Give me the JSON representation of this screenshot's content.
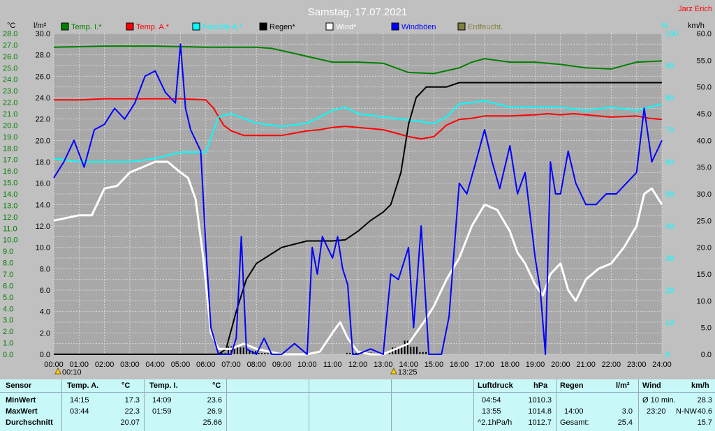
{
  "title": "Samstag, 17.07.2021",
  "author": "Jarz Erich",
  "units": {
    "left_c": "°C",
    "left_rain": "l/m²",
    "pct": "%",
    "kmh": "km/h"
  },
  "legend": [
    {
      "label": "Temp. I.*",
      "color": "#008000"
    },
    {
      "label": "Temp. A.*",
      "color": "#ff0000"
    },
    {
      "label": "Feuchte A.*",
      "color": "#00ffff"
    },
    {
      "label": "Regen*",
      "color": "#000000"
    },
    {
      "label": "Wind*",
      "color": "#ffffff"
    },
    {
      "label": "Windböen",
      "color": "#0000ff"
    },
    {
      "label": "Erdfeucht.",
      "color": "#808040"
    }
  ],
  "markers": [
    {
      "label": "00:10"
    },
    {
      "label": "13:25"
    }
  ],
  "chart_data": {
    "type": "line",
    "x_ticks": [
      "00:00",
      "01:00",
      "02:00",
      "03:00",
      "04:00",
      "05:00",
      "06:00",
      "07:00",
      "08:00",
      "09:00",
      "10:00",
      "11:00",
      "12:00",
      "13:00",
      "14:00",
      "15:00",
      "16:00",
      "17:00",
      "18:00",
      "19:00",
      "20:00",
      "21:00",
      "22:00",
      "23:00",
      "24:00"
    ],
    "y_left_temp_ticks": [
      "28.0",
      "27.0",
      "26.0",
      "25.0",
      "24.0",
      "23.0",
      "22.0",
      "21.0",
      "20.0",
      "19.0",
      "18.0",
      "17.0",
      "16.0",
      "15.0",
      "14.0",
      "13.0",
      "12.0",
      "11.0",
      "10.0",
      "9.0",
      "8.0",
      "7.0",
      "6.0",
      "5.0",
      "4.0",
      "3.0",
      "2.0",
      "1.0",
      "0.0"
    ],
    "y_left_rain_ticks": [
      "30.0",
      "28.0",
      "26.0",
      "24.0",
      "22.0",
      "20.0",
      "18.0",
      "16.0",
      "14.0",
      "12.0",
      "10.0",
      "8.0",
      "6.0",
      "4.0",
      "2.0",
      "0.0"
    ],
    "y_pct_ticks": [
      "100",
      "90",
      "80",
      "70",
      "60",
      "50",
      "40",
      "30",
      "20",
      "10",
      "0"
    ],
    "y_kmh_ticks": [
      "60.0",
      "55.0",
      "50.0",
      "45.0",
      "40.0",
      "35.0",
      "30.0",
      "25.0",
      "20.0",
      "15.0",
      "10.0",
      "5.0",
      "0.0"
    ],
    "temp_range": [
      0,
      28
    ],
    "rain_range": [
      0,
      30
    ],
    "pct_range": [
      0,
      100
    ],
    "kmh_range": [
      0,
      60
    ],
    "series": [
      {
        "name": "Temp. I.*",
        "axis": "temp",
        "color": "#008000",
        "x": [
          0,
          2,
          4,
          6,
          7,
          8,
          8.6,
          9,
          10,
          11,
          12,
          13,
          13.5,
          14,
          15,
          16,
          16.5,
          17,
          18,
          19,
          20,
          21,
          22,
          23,
          24
        ],
        "y": [
          26.8,
          26.9,
          26.9,
          26.8,
          26.8,
          26.8,
          26.7,
          26.5,
          26.0,
          25.5,
          25.5,
          25.4,
          25.0,
          24.6,
          24.5,
          25.0,
          25.5,
          25.8,
          25.5,
          25.5,
          25.3,
          25.0,
          24.9,
          25.5,
          25.6
        ]
      },
      {
        "name": "Temp. A.*",
        "axis": "temp",
        "color": "#ff0000",
        "x": [
          0,
          1,
          2,
          3,
          4,
          5,
          6,
          6.3,
          6.7,
          7,
          7.5,
          8,
          9,
          10,
          10.5,
          11,
          11.5,
          12,
          12.5,
          13,
          13.5,
          14,
          14.5,
          15,
          15.5,
          16,
          16.5,
          17,
          17.5,
          18,
          19,
          19.5,
          20,
          20.5,
          21,
          22,
          23,
          23.5,
          24
        ],
        "y": [
          22.2,
          22.2,
          22.3,
          22.3,
          22.3,
          22.3,
          22.2,
          21.5,
          20.0,
          19.5,
          19.1,
          19.1,
          19.1,
          19.5,
          19.6,
          19.8,
          19.9,
          19.8,
          19.7,
          19.6,
          19.3,
          19.0,
          18.8,
          19.0,
          20.0,
          20.5,
          20.6,
          20.8,
          20.8,
          20.8,
          20.9,
          21.0,
          20.9,
          21.0,
          20.9,
          20.7,
          20.8,
          20.6,
          20.5
        ]
      },
      {
        "name": "Feuchte A.*",
        "axis": "pct",
        "color": "#00ffff",
        "x": [
          0,
          1,
          2,
          3,
          4,
          5,
          6,
          6.5,
          7,
          8,
          9,
          10,
          11,
          11.5,
          12,
          13,
          14,
          15,
          15.5,
          16,
          17,
          18,
          19,
          20,
          21,
          22,
          23,
          24
        ],
        "y": [
          61,
          60,
          60,
          60,
          61,
          63,
          63,
          74,
          75,
          72,
          71,
          72,
          76,
          77,
          75,
          74,
          73,
          72,
          74,
          78,
          79,
          77,
          77,
          77,
          76,
          77,
          76,
          78
        ]
      },
      {
        "name": "Regen*",
        "axis": "rain",
        "color": "#000000",
        "x": [
          0,
          6.5,
          6.8,
          7.2,
          7.6,
          8,
          8.6,
          9,
          10,
          11,
          11.5,
          12,
          12.5,
          13,
          13.3,
          13.7,
          14,
          14.3,
          14.7,
          15,
          15.5,
          16,
          17,
          18,
          19,
          20,
          21,
          22,
          23,
          24
        ],
        "y": [
          0,
          0,
          0.5,
          4,
          7,
          8.5,
          9.4,
          10,
          10.6,
          10.6,
          10.7,
          11.5,
          12.5,
          13.3,
          14,
          17,
          21.5,
          24,
          25,
          25,
          25,
          25.4,
          25.4,
          25.4,
          25.4,
          25.4,
          25.4,
          25.4,
          25.4,
          25.4
        ]
      },
      {
        "name": "Wind*",
        "axis": "kmh",
        "color": "#ffffff",
        "x": [
          0,
          0.5,
          1,
          1.5,
          2,
          2.5,
          3,
          3.5,
          4,
          4.5,
          5,
          5.3,
          5.6,
          5.9,
          6.2,
          6.5,
          7,
          7.5,
          8,
          8.5,
          9,
          9.5,
          10,
          10.5,
          11,
          11.3,
          11.6,
          12,
          12.5,
          13,
          13.5,
          14,
          14.3,
          14.6,
          15,
          15.5,
          16,
          16.5,
          17,
          17.5,
          18,
          18.3,
          18.6,
          19,
          19.3,
          19.6,
          20,
          20.3,
          20.6,
          21,
          21.5,
          22,
          22.5,
          23,
          23.3,
          23.6,
          24
        ],
        "y": [
          25,
          25.5,
          26,
          26,
          31,
          31.5,
          34,
          35,
          36,
          36,
          34,
          33,
          29,
          18,
          4,
          1,
          1,
          2,
          1,
          0.5,
          0,
          0,
          0,
          0.5,
          4,
          6,
          3,
          0.5,
          0,
          0,
          1,
          2,
          4,
          6,
          9,
          14,
          18,
          24,
          28,
          27,
          23,
          19,
          17,
          13,
          11,
          15,
          17,
          12,
          10,
          14,
          16,
          17,
          20,
          24,
          30,
          31,
          28
        ]
      },
      {
        "name": "Windböen",
        "axis": "kmh",
        "color": "#0000ff",
        "x": [
          0,
          0.4,
          0.8,
          1.2,
          1.6,
          2,
          2.4,
          2.8,
          3.2,
          3.6,
          4,
          4.4,
          4.8,
          5,
          5.2,
          5.4,
          5.6,
          5.8,
          6,
          6.2,
          6.5,
          7,
          7.2,
          7.4,
          7.6,
          8,
          8.3,
          8.6,
          9,
          9.5,
          10,
          10.2,
          10.4,
          10.6,
          11,
          11.2,
          11.4,
          11.6,
          11.8,
          12,
          12.5,
          13,
          13.3,
          13.6,
          14,
          14.2,
          14.5,
          14.8,
          15,
          15.3,
          15.6,
          16,
          16.3,
          16.6,
          17,
          17.3,
          17.6,
          18,
          18.3,
          18.6,
          19,
          19.2,
          19.4,
          19.6,
          19.8,
          20,
          20.3,
          20.6,
          21,
          21.4,
          21.8,
          22.2,
          22.6,
          23,
          23.3,
          23.6,
          24
        ],
        "y": [
          33,
          36,
          40,
          35,
          42,
          43,
          46,
          44,
          47,
          52,
          53,
          49,
          47,
          58,
          46,
          42,
          40,
          38,
          20,
          5,
          0,
          0,
          3,
          22,
          1,
          0,
          3,
          0,
          0,
          2,
          0,
          20,
          15,
          22,
          18,
          22,
          16,
          13,
          0,
          0,
          1,
          0,
          15,
          14,
          20,
          5,
          24,
          0,
          0,
          0,
          7,
          32,
          30,
          35,
          42,
          36,
          31,
          39,
          30,
          34,
          18,
          12,
          0,
          36,
          30,
          30,
          38,
          32,
          28,
          28,
          30,
          30,
          32,
          34,
          46,
          36,
          40
        ]
      }
    ],
    "rain_bars_note": "",
    "line_widths": {}
  },
  "summary": {
    "sensor": {
      "title": "Sensor",
      "rows": [
        "MinWert",
        "MaxWert",
        "Durchschnitt"
      ]
    },
    "temp_a": {
      "title": "Temp. A.",
      "unit": "°C",
      "times": [
        "14:15",
        "03:44",
        ""
      ],
      "values": [
        "17.3",
        "22.3",
        "20.07"
      ]
    },
    "temp_i": {
      "title": "Temp. I.",
      "unit": "°C",
      "times": [
        "14:09",
        "01:59",
        ""
      ],
      "values": [
        "23.6",
        "26.9",
        "25.66"
      ]
    },
    "pressure": {
      "title": "Luftdruck",
      "unit": "hPa",
      "times": [
        "04:54",
        "13:55",
        "^2.1hPa/h"
      ],
      "values": [
        "1010.3",
        "1014.8",
        "1012.7"
      ]
    },
    "rain": {
      "title": "Regen",
      "unit": "l/m²",
      "times": [
        "",
        "14:00",
        "Gesamt:"
      ],
      "values": [
        "",
        "3.0",
        "25.4"
      ]
    },
    "wind": {
      "title": "Wind",
      "unit": "km/h",
      "times": [
        "Ø 10 min.",
        "23:20",
        ""
      ],
      "dirs": [
        "",
        "N-NW",
        ""
      ],
      "values": [
        "28.3",
        "40.6",
        "15.7"
      ]
    }
  }
}
